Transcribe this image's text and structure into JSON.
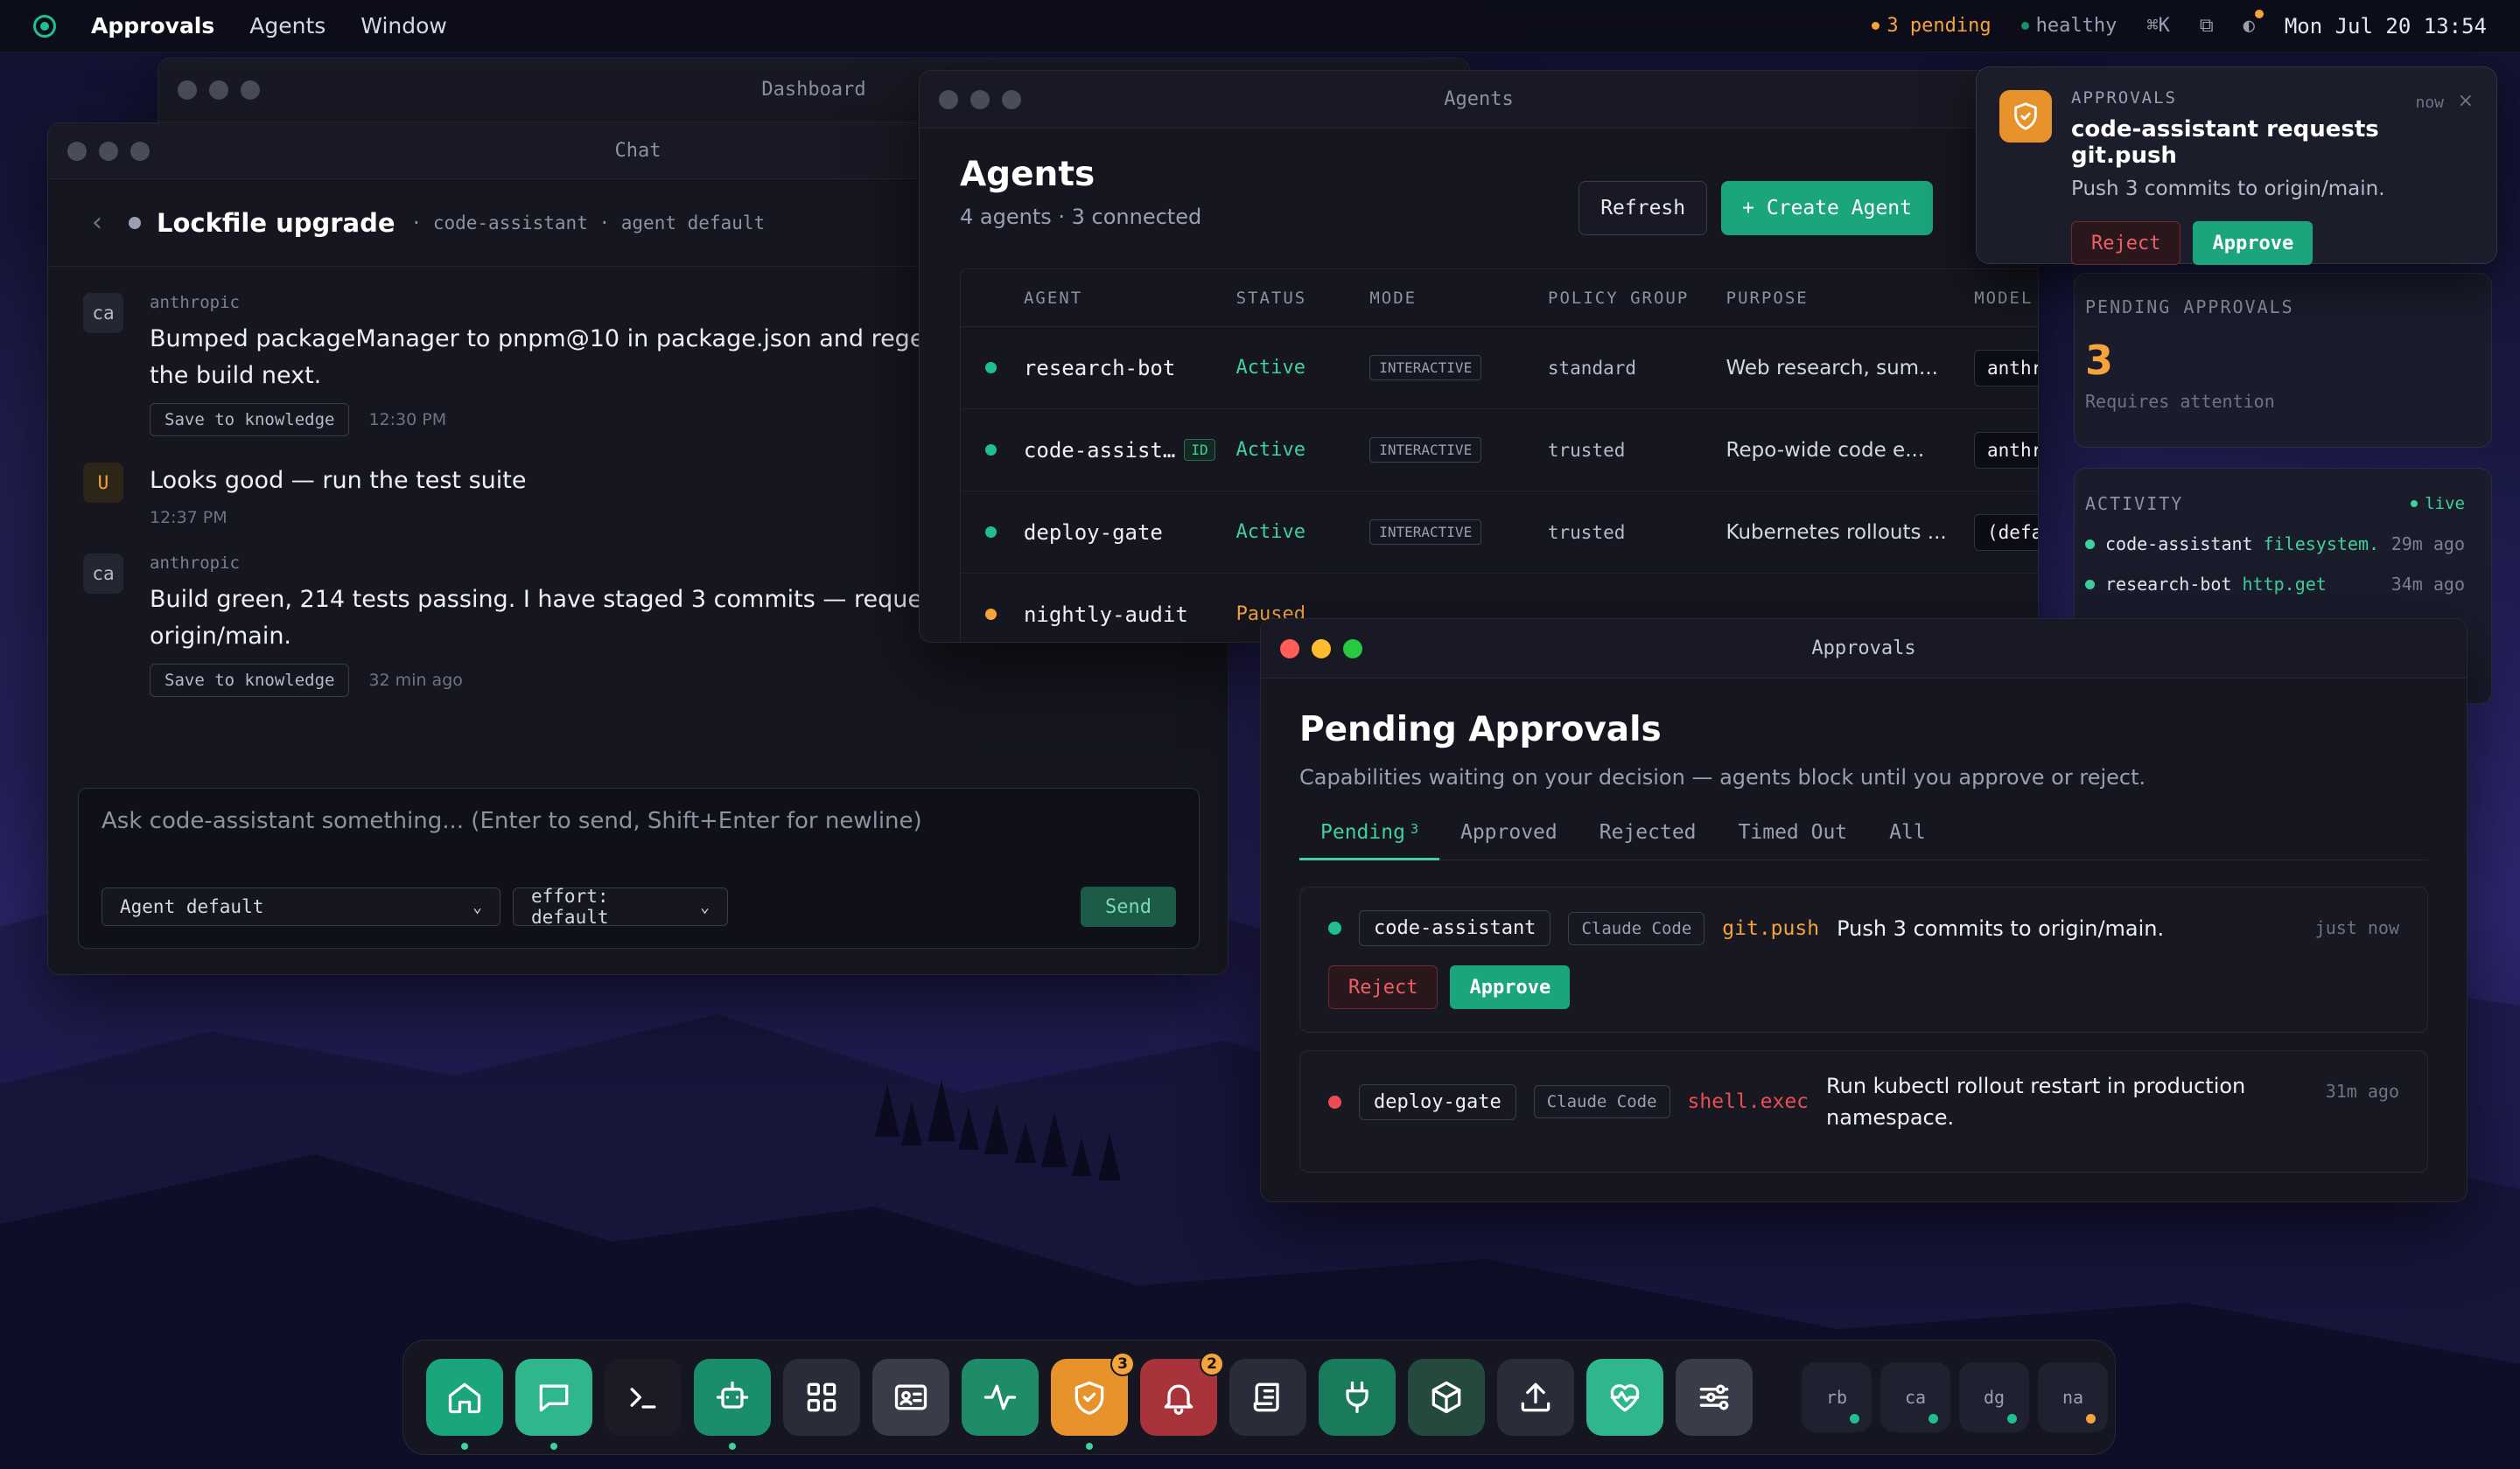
{
  "menubar": {
    "app_name": "Approvals",
    "menus": [
      "Agents",
      "Window"
    ],
    "pending_status": "3 pending",
    "health_status": "healthy",
    "shortcut_hint": "⌘K",
    "window_icon": "⧉",
    "theme_icon": "◐",
    "clock": "Mon Jul 20 13:54",
    "colors": {
      "accent": "#1fbf8f",
      "warning": "#f4a43a"
    }
  },
  "dashboard_window": {
    "title": "Dashboard"
  },
  "chat_window": {
    "title": "Chat",
    "back_icon": "‹",
    "conversation_title": "Lockfile upgrade",
    "meta": "· code-assistant · agent default",
    "messages": [
      {
        "avatar": "ca",
        "source": "anthropic",
        "text_line1": "Bumped packageManager to pnpm@10 in package.json and regenerat",
        "text_line2": "the build next.",
        "knowledge_button": "Save to knowledge",
        "time": "12:30 PM"
      },
      {
        "avatar": "U",
        "text_line1": "Looks good — run the test suite",
        "time": "12:37 PM"
      },
      {
        "avatar": "ca",
        "source": "anthropic",
        "text_line1": "Build green, 214 tests passing. I have staged 3 commits — requesting a",
        "text_line2": "origin/main.",
        "knowledge_button": "Save to knowledge",
        "time": "32 min ago"
      }
    ],
    "composer": {
      "placeholder": "Ask code-assistant something... (Enter to send, Shift+Enter for newline)",
      "agent_select": "Agent default",
      "effort_select": "effort: default",
      "send_label": "Send"
    }
  },
  "agents_window": {
    "title": "Agents",
    "heading": "Agents",
    "subtitle": "4 agents · 3 connected",
    "refresh_label": "Refresh",
    "create_label": "+ Create Agent",
    "columns": [
      "AGENT",
      "STATUS",
      "MODE",
      "POLICY GROUP",
      "PURPOSE",
      "MODEL"
    ],
    "rows": [
      {
        "name": "research-bot",
        "id_badge": "",
        "status": "Active",
        "mode": "INTERACTIVE",
        "policy": "standard",
        "purpose": "Web research, sum...",
        "model": "anthropic",
        "dot_color": "#1fbf8f"
      },
      {
        "name": "code-assist…",
        "id_badge": "ID",
        "status": "Active",
        "mode": "INTERACTIVE",
        "policy": "trusted",
        "purpose": "Repo-wide code e...",
        "model": "anthropic",
        "dot_color": "#1fbf8f"
      },
      {
        "name": "deploy-gate",
        "id_badge": "",
        "status": "Active",
        "mode": "INTERACTIVE",
        "policy": "trusted",
        "purpose": "Kubernetes rollouts ...",
        "model": "(default)",
        "dot_color": "#1fbf8f"
      },
      {
        "name": "nightly-audit",
        "id_badge": "",
        "status": "Paused",
        "mode": "",
        "policy": "",
        "purpose": "",
        "model": "",
        "dot_color": "#f4a43a"
      }
    ]
  },
  "side_cards": {
    "pending_label": "PENDING APPROVALS",
    "pending_count": "3",
    "pending_sub": "Requires attention",
    "activity_label": "ACTIVITY",
    "live_label": "live",
    "activity": [
      {
        "agent": "code-assistant",
        "capability": "filesystem.read",
        "time": "29m ago"
      },
      {
        "agent": "research-bot",
        "capability": "http.get",
        "time": "34m ago"
      }
    ]
  },
  "toast": {
    "label": "APPROVALS",
    "title": "code-assistant requests git.push",
    "message": "Push 3 commits to origin/main.",
    "time": "now",
    "close": "×",
    "reject_label": "Reject",
    "approve_label": "Approve"
  },
  "approvals_window": {
    "title": "Approvals",
    "heading": "Pending Approvals",
    "subtitle": "Capabilities waiting on your decision — agents block until you approve or reject.",
    "tabs": [
      {
        "label": "Pending",
        "count": "3"
      },
      {
        "label": "Approved"
      },
      {
        "label": "Rejected"
      },
      {
        "label": "Timed Out"
      },
      {
        "label": "All"
      }
    ],
    "requests": [
      {
        "agent": "code-assistant",
        "kind": "Claude Code",
        "capability": "git.push",
        "description": "Push 3 commits to origin/main.",
        "time": "just now",
        "reject_label": "Reject",
        "approve_label": "Approve",
        "dot_color": "#1fbf8f",
        "cap_color": "#f4a43a"
      },
      {
        "agent": "deploy-gate",
        "kind": "Claude Code",
        "capability": "shell.exec",
        "description_line1": "Run kubectl rollout restart in production",
        "description_line2": "namespace.",
        "time": "31m ago",
        "dot_color": "#ef4b55",
        "cap_color": "#ef4b55"
      }
    ]
  },
  "dock": {
    "apps": [
      {
        "name": "home-icon",
        "bg": "#1aa57c",
        "running": true
      },
      {
        "name": "chat-icon",
        "bg": "#2fb68c",
        "running": true
      },
      {
        "name": "terminal-icon",
        "bg": "#1a1b24",
        "running": false
      },
      {
        "name": "agents-icon",
        "bg": "#1a8e6b",
        "running": true
      },
      {
        "name": "apps-grid-icon",
        "bg": "#2a2c3a",
        "running": false
      },
      {
        "name": "identity-card-icon",
        "bg": "#3a3c4a",
        "running": false
      },
      {
        "name": "activity-icon",
        "bg": "#1e8c68",
        "running": false
      },
      {
        "name": "shield-icon",
        "bg": "#e8922c",
        "running": true,
        "badge": "3"
      },
      {
        "name": "bell-icon",
        "bg": "#a8333b",
        "running": false,
        "badge": "2"
      },
      {
        "name": "scroll-icon",
        "bg": "#2a2c3a",
        "running": false
      },
      {
        "name": "plug-icon",
        "bg": "#1a7a5c",
        "running": false
      },
      {
        "name": "package-icon",
        "bg": "#244a3e",
        "running": false
      },
      {
        "name": "upload-icon",
        "bg": "#2a2c3a",
        "running": false
      },
      {
        "name": "heart-pulse-icon",
        "bg": "#2fb68c",
        "running": false
      },
      {
        "name": "sliders-icon",
        "bg": "#3a3c4a",
        "running": false
      }
    ],
    "agents": [
      {
        "label": "rb",
        "dot": "#1fbf8f"
      },
      {
        "label": "ca",
        "dot": "#1fbf8f"
      },
      {
        "label": "dg",
        "dot": "#1fbf8f"
      },
      {
        "label": "na",
        "dot": "#f4a43a"
      }
    ]
  }
}
